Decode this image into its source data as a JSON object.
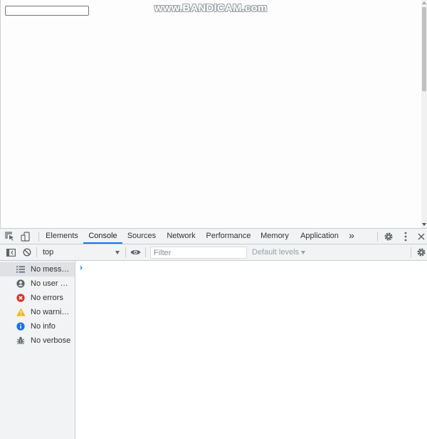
{
  "page": {
    "input_value": "",
    "watermark": "www.BANDICAM.com"
  },
  "devtools": {
    "tabs": [
      {
        "label": "Elements",
        "active": false
      },
      {
        "label": "Console",
        "active": true
      },
      {
        "label": "Sources",
        "active": false
      },
      {
        "label": "Network",
        "active": false
      },
      {
        "label": "Performance",
        "active": false
      },
      {
        "label": "Memory",
        "active": false
      },
      {
        "label": "Application",
        "active": false
      }
    ],
    "more_tabs": "»",
    "toolbar": {
      "context": "top",
      "filter_placeholder": "Filter",
      "levels": "Default levels"
    },
    "sidebar": [
      {
        "label": "No messages",
        "icon": "list-icon",
        "selected": true
      },
      {
        "label": "No user me...",
        "icon": "user-icon",
        "selected": false
      },
      {
        "label": "No errors",
        "icon": "error-icon",
        "selected": false
      },
      {
        "label": "No warnings",
        "icon": "warning-icon",
        "selected": false
      },
      {
        "label": "No info",
        "icon": "info-icon",
        "selected": false
      },
      {
        "label": "No verbose",
        "icon": "bug-icon",
        "selected": false
      }
    ],
    "prompt": "›"
  },
  "colors": {
    "accent": "#1a73e8",
    "error": "#d93025",
    "warning": "#f2b600",
    "info": "#1a73e8",
    "panel_bg": "#f1f3f4"
  }
}
